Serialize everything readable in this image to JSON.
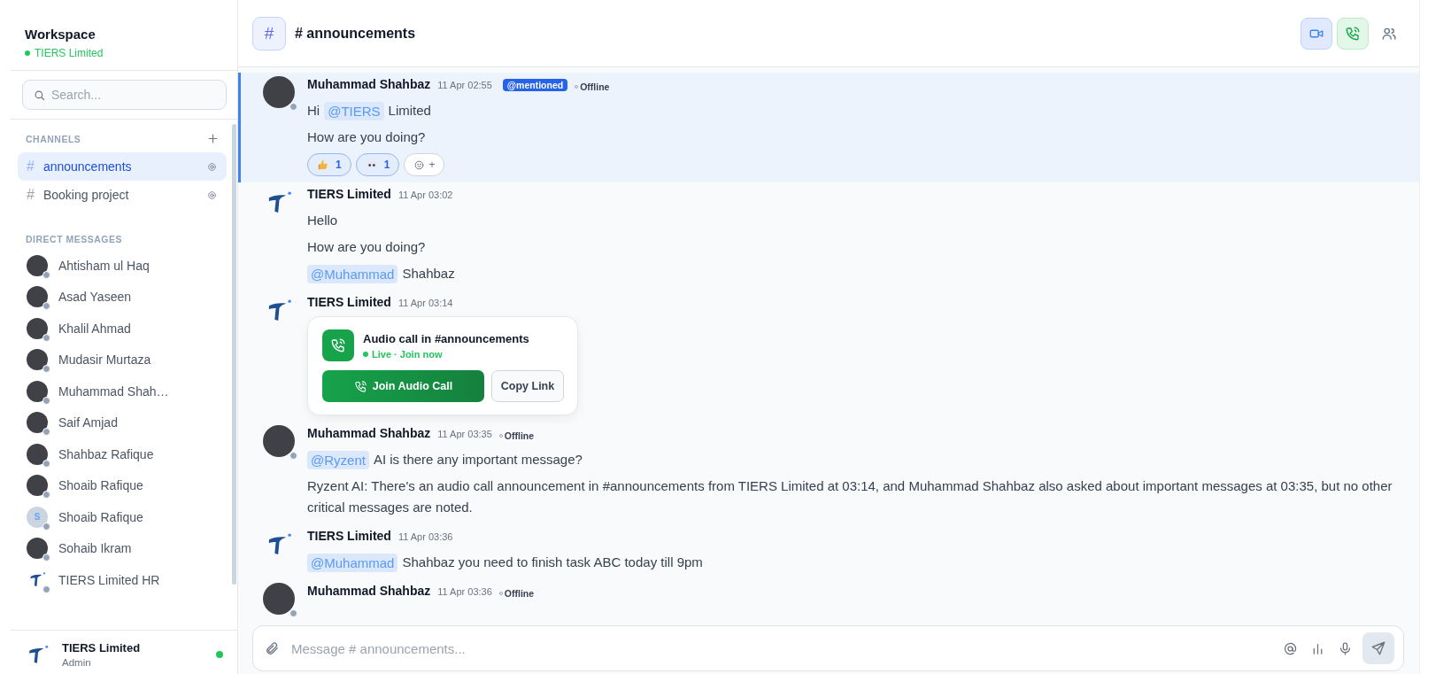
{
  "sidebar": {
    "workspace_title": "Workspace",
    "workspace_name": "TIERS Limited",
    "search": {
      "placeholder": "Search..."
    },
    "channels_heading": "CHANNELS",
    "channels": [
      {
        "hash": "#",
        "name": "announcements",
        "selected": true
      },
      {
        "hash": "#",
        "name": "Booking project",
        "selected": false
      }
    ],
    "dm_heading": "DIRECT MESSAGES",
    "direct_messages": [
      {
        "name": "Ahtisham ul Haq",
        "kind": "photo",
        "online": false
      },
      {
        "name": "Asad Yaseen",
        "kind": "photo",
        "online": false
      },
      {
        "name": "Khalil Ahmad",
        "kind": "photo",
        "online": false
      },
      {
        "name": "Mudasir Murtaza",
        "kind": "photo",
        "online": false
      },
      {
        "name": "Muhammad Shah…",
        "kind": "photo",
        "online": false
      },
      {
        "name": "Saif Amjad",
        "kind": "photo",
        "online": false
      },
      {
        "name": "Shahbaz Rafique",
        "kind": "photo",
        "online": false
      },
      {
        "name": "Shoaib Rafique",
        "kind": "photo",
        "online": false
      },
      {
        "name": "Shoaib Rafique",
        "kind": "initial",
        "initial": "S",
        "online": false
      },
      {
        "name": "Sohaib Ikram",
        "kind": "photo",
        "online": false
      },
      {
        "name": "TIERS Limited HR",
        "kind": "logo",
        "online": false
      }
    ],
    "user": {
      "name": "TIERS Limited",
      "role": "Admin",
      "online": true
    }
  },
  "channel_header": {
    "hash": "#",
    "title": "# announcements",
    "actions": [
      {
        "kind": "video"
      },
      {
        "kind": "phone"
      },
      {
        "kind": "members"
      }
    ]
  },
  "messages": [
    {
      "author": "Muhammad Shahbaz",
      "kind": "photo",
      "online": false,
      "time": "11 Apr 02:55",
      "badge": "@mentioned",
      "presence": "Offline",
      "highlighted": true,
      "lines": [
        [
          {
            "kind": "text",
            "text": "Hi"
          },
          {
            "kind": "mention",
            "text": "@TIERS"
          },
          {
            "kind": "text",
            "text": "Limited"
          }
        ],
        [
          {
            "kind": "text",
            "text": "How are you doing?"
          }
        ]
      ],
      "reactions": [
        {
          "kind": "thumbs-up",
          "count": "1",
          "selected": true
        },
        {
          "kind": "eyes",
          "count": "1",
          "selected": true
        }
      ],
      "add_reaction": "+"
    },
    {
      "author": "TIERS Limited",
      "kind": "logo",
      "time": "11 Apr 03:02",
      "highlighted": false,
      "lines": [
        [
          {
            "kind": "text",
            "text": "Hello"
          }
        ],
        [
          {
            "kind": "text",
            "text": "How are you doing?"
          }
        ],
        [
          {
            "kind": "mention",
            "text": "@Muhammad"
          },
          {
            "kind": "text",
            "text": "Shahbaz"
          }
        ]
      ]
    },
    {
      "author": "TIERS Limited",
      "kind": "logo",
      "time": "11 Apr 03:14",
      "highlighted": false,
      "call_card": {
        "title": "Audio call in #announcements",
        "status": "Live · Join now",
        "join_label": "Join Audio Call",
        "copy_label": "Copy Link"
      }
    },
    {
      "author": "Muhammad Shahbaz",
      "kind": "photo",
      "online": false,
      "time": "11 Apr 03:35",
      "presence": "Offline",
      "highlighted": false,
      "lines": [
        [
          {
            "kind": "mention",
            "text": "@Ryzent"
          },
          {
            "kind": "text",
            "text": "AI is there any important message?"
          }
        ],
        [
          {
            "kind": "text",
            "text": "Ryzent AI: There's an audio call announcement in #announcements from TIERS Limited at 03:14, and Muhammad Shahbaz also asked about important messages at 03:35, but no other critical messages are noted."
          }
        ]
      ]
    },
    {
      "author": "TIERS Limited",
      "kind": "logo",
      "time": "11 Apr 03:36",
      "highlighted": false,
      "lines": [
        [
          {
            "kind": "mention",
            "text": "@Muhammad"
          },
          {
            "kind": "text",
            "text": "Shahbaz you need to finish task ABC today till 9pm"
          }
        ]
      ]
    },
    {
      "author": "Muhammad Shahbaz",
      "kind": "photo",
      "online": false,
      "time": "11 Apr 03:36",
      "presence": "Offline",
      "highlighted": false
    }
  ],
  "composer": {
    "placeholder": "Message # announcements...",
    "tools": [
      {
        "kind": "mention"
      },
      {
        "kind": "chart"
      },
      {
        "kind": "mic"
      }
    ]
  }
}
